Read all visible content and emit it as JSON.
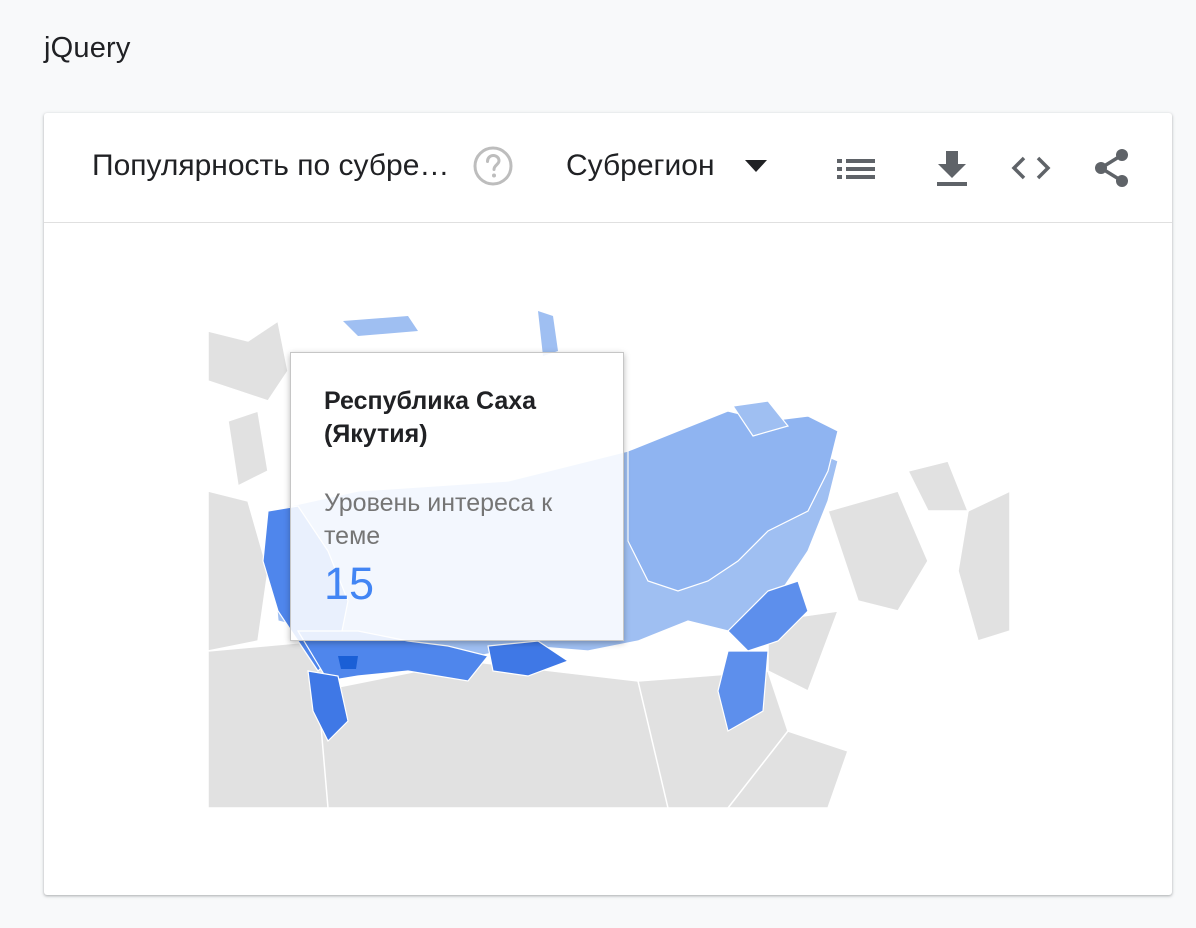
{
  "page": {
    "title": "jQuery"
  },
  "widget": {
    "title": "Популярность по субрегионам",
    "resolution_selected": "Субрегион"
  },
  "icons": {
    "help": "help-circle-icon",
    "dropdown": "triangle-down-icon",
    "list": "list-view-icon",
    "download": "download-icon",
    "embed": "code-embed-icon",
    "share": "share-icon"
  },
  "tooltip": {
    "region": "Республика Саха (Якутия)",
    "metric_label": "Уровень интереса к теме",
    "value": "15"
  },
  "colors": {
    "value_blue": "#4285f4",
    "map_high": "#1a5fd6",
    "map_mid": "#4f86ec",
    "map_low": "#9fbff2",
    "map_none": "#e1e1e1"
  }
}
